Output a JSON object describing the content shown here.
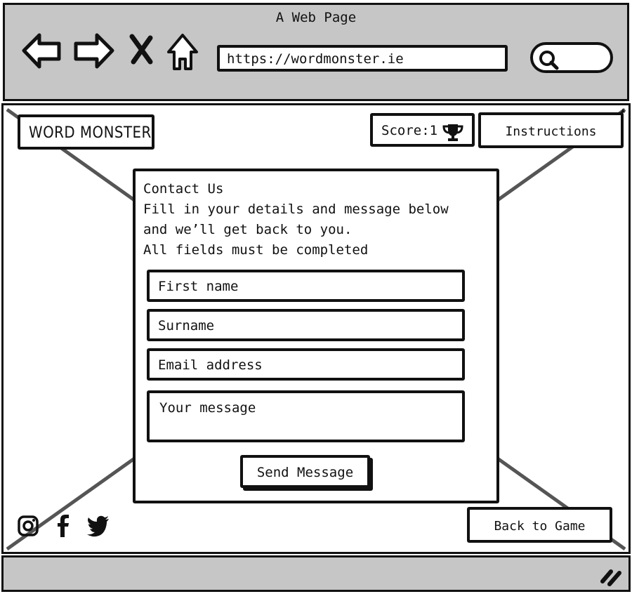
{
  "browser": {
    "window_title": "A Web Page",
    "url": "https://wordmonster.ie",
    "icons": [
      "back-arrow-icon",
      "forward-arrow-icon",
      "close-icon",
      "home-icon",
      "search-icon"
    ]
  },
  "header": {
    "logo": "WORD MONSTER",
    "score_label": "Score:1",
    "score_icon": "trophy-icon",
    "instructions": "Instructions"
  },
  "contact": {
    "title": "Contact Us",
    "line1": "Fill in your details and message below",
    "line2": "and we’ll get back to you.",
    "line3": "All fields must be completed",
    "first_name_placeholder": "First name",
    "surname_placeholder": "Surname",
    "email_placeholder": "Email address",
    "message_placeholder": "Your message",
    "send_label": "Send Message"
  },
  "footer": {
    "social": [
      "instagram-icon",
      "facebook-icon",
      "twitter-icon"
    ],
    "back_label": "Back to Game"
  }
}
